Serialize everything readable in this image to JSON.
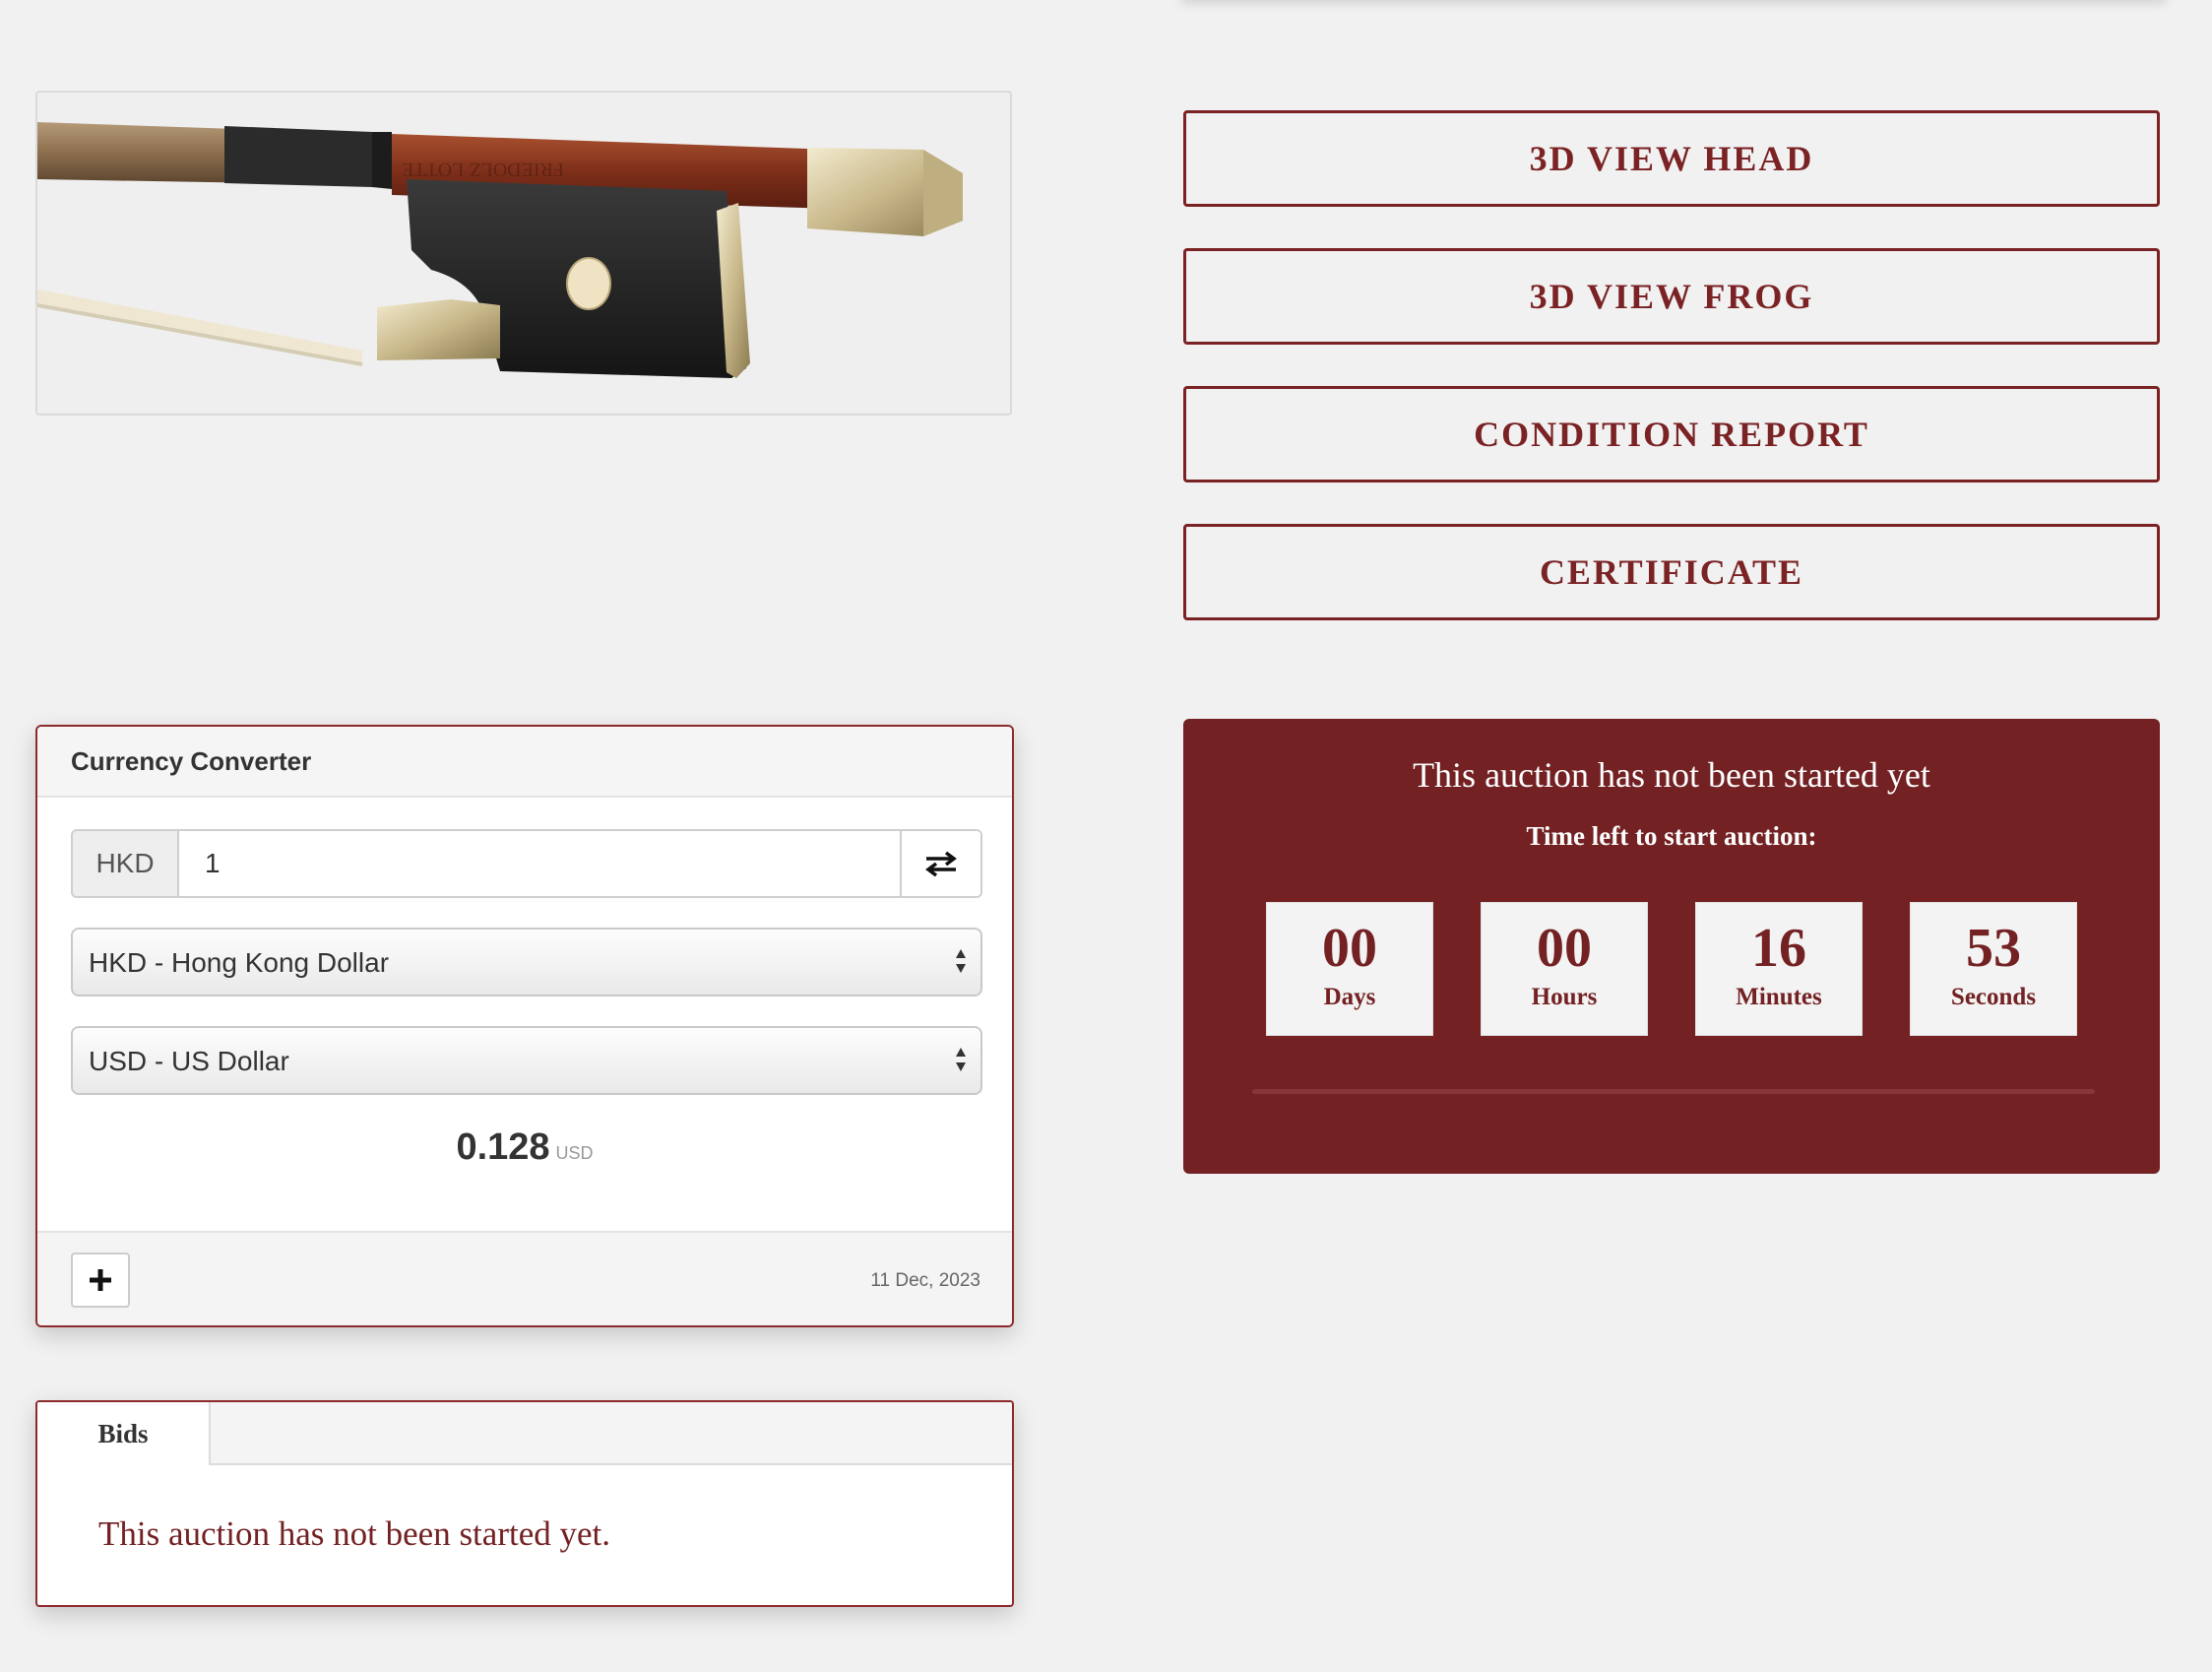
{
  "buttons": {
    "view_head": "3D VIEW HEAD",
    "view_frog": "3D VIEW FROG",
    "condition_report": "CONDITION REPORT",
    "certificate": "CERTIFICATE"
  },
  "auction": {
    "status": "This auction has not been started yet",
    "time_left_label": "Time left to start auction:",
    "countdown": [
      {
        "value": "00",
        "label": "Days"
      },
      {
        "value": "00",
        "label": "Hours"
      },
      {
        "value": "16",
        "label": "Minutes"
      },
      {
        "value": "53",
        "label": "Seconds"
      }
    ],
    "accent_color": "#732123"
  },
  "currency_converter": {
    "title": "Currency Converter",
    "base_code": "HKD",
    "amount": "1",
    "from_currency": "HKD - Hong Kong Dollar",
    "to_currency": "USD - US Dollar",
    "result_value": "0.128",
    "result_unit": "USD",
    "date": "11 Dec, 2023",
    "swap_icon": "swap-icon",
    "add_icon": "plus-icon"
  },
  "bids": {
    "tab_label": "Bids",
    "message": "This auction has not been started yet."
  },
  "image": {
    "bow_engraving": "FRIEDOLZ LOTTE"
  }
}
